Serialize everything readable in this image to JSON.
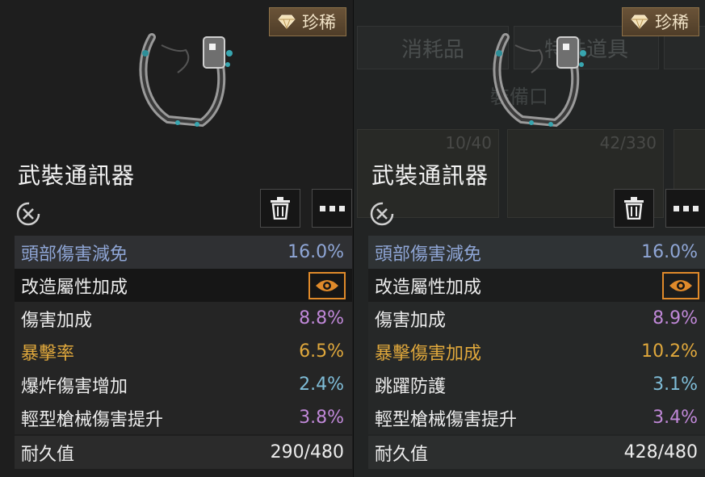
{
  "colors": {
    "blue": "#8fa6d6",
    "white": "#ececec",
    "purple": "#c088d8",
    "gold": "#e0a83c",
    "teal": "#7fbdd8",
    "eye_orange": "#e08a2a"
  },
  "background_ui": {
    "tab_consumables": "消耗品",
    "tab_items": "特殊道具",
    "section": "裝備口",
    "card1_count": "10/40",
    "card2_count": "42/330"
  },
  "panels": [
    {
      "rarity_label": "珍稀",
      "rarity_icon": "gem-icon",
      "item_name": "武裝通訊器",
      "stats": [
        {
          "label": "頭部傷害減免",
          "value": "16.0%",
          "label_color": "blue",
          "value_color": "blue"
        },
        {
          "label": "改造屬性加成",
          "value": null,
          "label_color": "white",
          "icon": "eye-icon"
        },
        {
          "label": "傷害加成",
          "value": "8.8%",
          "label_color": "white",
          "value_color": "purple"
        },
        {
          "label": "暴擊率",
          "value": "6.5%",
          "label_color": "gold",
          "value_color": "gold"
        },
        {
          "label": "爆炸傷害增加",
          "value": "2.4%",
          "label_color": "white",
          "value_color": "teal"
        },
        {
          "label": "輕型槍械傷害提升",
          "value": "3.8%",
          "label_color": "white",
          "value_color": "purple"
        }
      ],
      "durability_label": "耐久值",
      "durability_value": "290/480"
    },
    {
      "rarity_label": "珍稀",
      "rarity_icon": "gem-icon",
      "item_name": "武裝通訊器",
      "stats": [
        {
          "label": "頭部傷害減免",
          "value": "16.0%",
          "label_color": "blue",
          "value_color": "blue"
        },
        {
          "label": "改造屬性加成",
          "value": null,
          "label_color": "white",
          "icon": "eye-icon"
        },
        {
          "label": "傷害加成",
          "value": "8.9%",
          "label_color": "white",
          "value_color": "purple"
        },
        {
          "label": "暴擊傷害加成",
          "value": "10.2%",
          "label_color": "gold",
          "value_color": "gold"
        },
        {
          "label": "跳躍防護",
          "value": "3.1%",
          "label_color": "white",
          "value_color": "teal"
        },
        {
          "label": "輕型槍械傷害提升",
          "value": "3.4%",
          "label_color": "white",
          "value_color": "purple"
        }
      ],
      "durability_label": "耐久值",
      "durability_value": "428/480"
    }
  ]
}
